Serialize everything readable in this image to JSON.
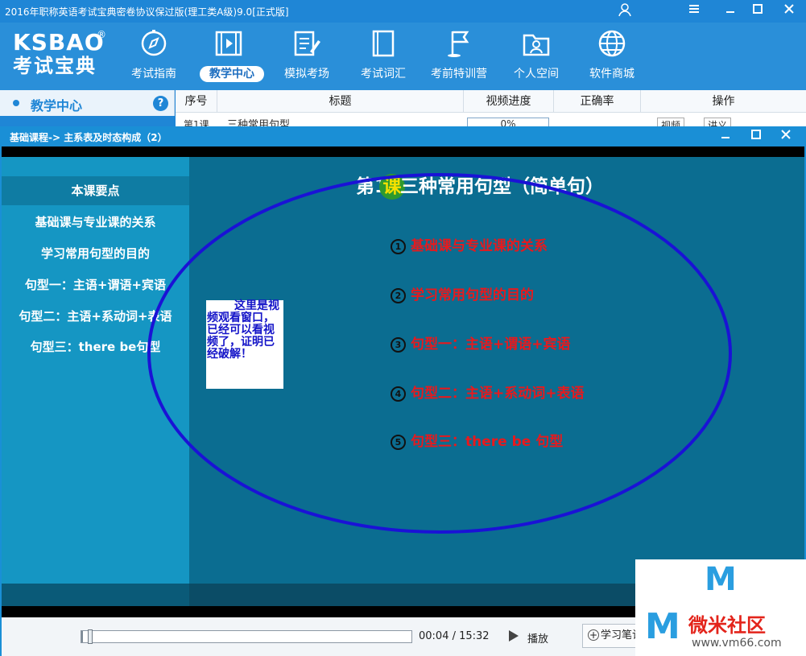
{
  "window": {
    "title": "2016年职称英语考试宝典密卷协议保过版(理工类A级)9.0[正式版]"
  },
  "logo": {
    "text": "KSBAO",
    "subtitle": "考试宝典",
    "reg": "®"
  },
  "nav": [
    {
      "label": "考试指南",
      "icon": "compass-icon"
    },
    {
      "label": "教学中心",
      "icon": "video-icon",
      "active": true
    },
    {
      "label": "模拟考场",
      "icon": "edit-paper-icon"
    },
    {
      "label": "考试词汇",
      "icon": "book-icon"
    },
    {
      "label": "考前特训营",
      "icon": "flag-icon"
    },
    {
      "label": "个人空间",
      "icon": "user-folder-icon"
    },
    {
      "label": "软件商城",
      "icon": "globe-icon"
    }
  ],
  "sidebar": {
    "title": "教学中心",
    "help": "?"
  },
  "table": {
    "headers": [
      "序号",
      "标题",
      "视频进度",
      "正确率",
      "操作"
    ],
    "row_peek": {
      "index": "第1课",
      "title": "三种常用句型",
      "progress": "0%",
      "op1": "视频",
      "op2": "讲义"
    }
  },
  "dialog": {
    "title": "基础课程-> 主系表及时态构成（2）",
    "keypoints_title": "本课要点",
    "keypoints": [
      "基础课与专业课的关系",
      "学习常用句型的目的",
      "句型一：主语+谓语+宾语",
      "句型二：主语+系动词+表语",
      "句型三：there be句型"
    ],
    "lesson_title_pre": "第1",
    "lesson_title_badge": "课",
    "lesson_title_post": "三种常用句型（简单句）",
    "points": [
      {
        "num": "1",
        "text": "基础课与专业课的关系"
      },
      {
        "num": "2",
        "text": "学习常用句型的目的"
      },
      {
        "num": "3",
        "text": "句型一：主语+谓语+宾语"
      },
      {
        "num": "4",
        "text": "句型二：主语+系动词+表语"
      },
      {
        "num": "5",
        "text": "句型三：there be 句型"
      }
    ],
    "note": "这里是视频观看窗口，已经可以看视频了，证明已经破解！",
    "time": "00:04 / 15:32",
    "play_label": "播放",
    "notes_button": "学习笔记",
    "progress": 0.004
  },
  "watermark": {
    "brand": "微米社区",
    "url": "www.vm66.com"
  },
  "colors": {
    "accent": "#1f86d6",
    "point_red": "#e8191d",
    "ellipse": "#1a12d6"
  }
}
